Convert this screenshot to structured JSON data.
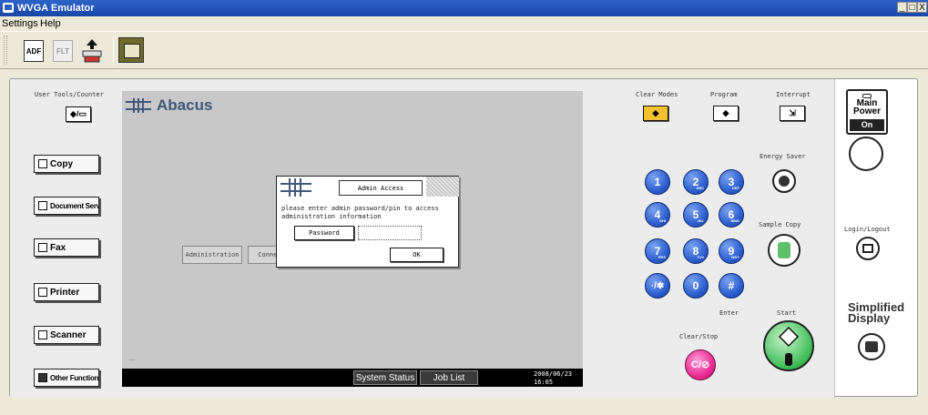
{
  "window": {
    "title": "WVGA Emulator",
    "controls": [
      "_",
      "□",
      "X"
    ]
  },
  "menu": {
    "items": [
      "Settings",
      "Help"
    ]
  },
  "toolbar": {
    "adf_label": "ADF",
    "dim_label": "FLT"
  },
  "left": {
    "user_tools_label": "User Tools/Counter",
    "buttons": [
      "Copy",
      "Document Server",
      "Fax",
      "Printer",
      "Scanner",
      "Other Function"
    ]
  },
  "screen": {
    "logo": "Abacus",
    "tabs": {
      "administration": "Administration",
      "connect": "Connect/Retry..."
    },
    "dots": "...",
    "dialog": {
      "header": "Admin Access",
      "message": "please enter admin password/pin to access administration information",
      "password_label": "Password",
      "password_value": "",
      "ok_label": "OK"
    },
    "status": {
      "system_status": "System Status",
      "job_list": "Job List",
      "date": "2008/06/23",
      "time": "16:05"
    }
  },
  "right": {
    "clear_modes": "Clear Modes",
    "program": "Program",
    "interrupt": "Interrupt",
    "energy_saver": "Energy Saver",
    "sample_copy": "Sample Copy",
    "enter": "Enter",
    "clear_stop": "Clear/Stop",
    "start": "Start",
    "keys": [
      {
        "label": "1",
        "sub": ""
      },
      {
        "label": "2",
        "sub": "ABC"
      },
      {
        "label": "3",
        "sub": "DEF"
      },
      {
        "label": "4",
        "sub": "GHI"
      },
      {
        "label": "5",
        "sub": "JKL"
      },
      {
        "label": "6",
        "sub": "MNO"
      },
      {
        "label": "7",
        "sub": "PRS"
      },
      {
        "label": "8",
        "sub": "TUV"
      },
      {
        "label": "9",
        "sub": "WXY"
      },
      {
        "label": "·/✱",
        "sub": ""
      },
      {
        "label": "0",
        "sub": ""
      },
      {
        "label": "#",
        "sub": ""
      }
    ]
  },
  "far_right": {
    "main_power_line1": "Main",
    "main_power_line2": "Power",
    "main_power_state": "On",
    "login_logout": "Login/Logout",
    "simplified_line1": "Simplified",
    "simplified_line2": "Display"
  }
}
